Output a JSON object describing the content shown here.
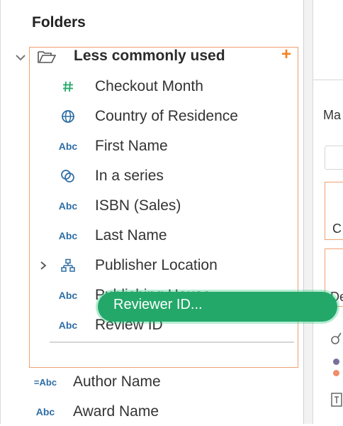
{
  "panel": {
    "title": "Folders"
  },
  "folder": {
    "name": "Less commonly used",
    "add_symbol": "+",
    "accent_color": "#f58220",
    "border_color": "#f0a070",
    "fields": [
      {
        "icon": "hash-icon",
        "icon_text": "#",
        "label": "Checkout Month"
      },
      {
        "icon": "globe-icon",
        "icon_text": "",
        "label": "Country of Residence"
      },
      {
        "icon": "abc-icon",
        "icon_text": "Abc",
        "label": "First Name"
      },
      {
        "icon": "set-icon",
        "icon_text": "",
        "label": "In a series"
      },
      {
        "icon": "abc-icon",
        "icon_text": "Abc",
        "label": "ISBN (Sales)"
      },
      {
        "icon": "abc-icon",
        "icon_text": "Abc",
        "label": "Last Name"
      },
      {
        "icon": "hierarchy-icon",
        "icon_text": "",
        "label": "Publisher Location"
      },
      {
        "icon": "abc-icon",
        "icon_text": "Abc",
        "label": "Publishing House"
      },
      {
        "icon": "abc-icon",
        "icon_text": "Abc",
        "label": "Review ID"
      }
    ]
  },
  "root_fields": [
    {
      "icon": "calculated-abc-icon",
      "icon_text": "=Abc",
      "label": "Author Name"
    },
    {
      "icon": "abc-icon",
      "icon_text": "Abc",
      "label": "Award Name"
    }
  ],
  "drag": {
    "label": "Reviewer ID...",
    "color": "#24a86a"
  },
  "right_pane": {
    "marks_label": "Ma",
    "c_label": "C",
    "d_label": "De"
  }
}
